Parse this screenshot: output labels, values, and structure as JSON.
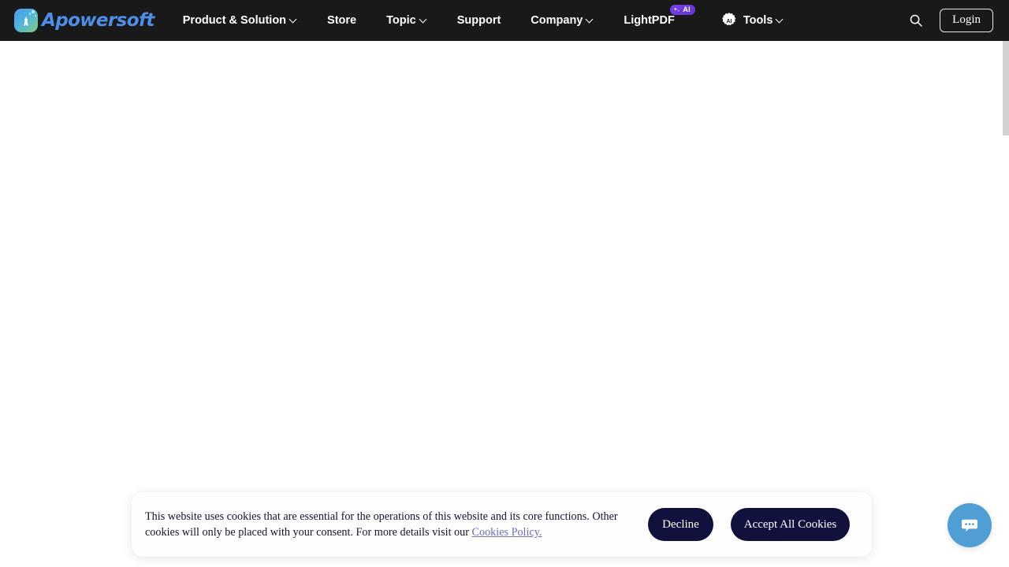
{
  "header": {
    "brand": {
      "name": "Apowersoft",
      "logo_icon": "apowersoft-logo-icon"
    },
    "nav": [
      {
        "label": "Product & Solution",
        "has_caret": true,
        "badge": null
      },
      {
        "label": "Store",
        "has_caret": false,
        "badge": null
      },
      {
        "label": "Topic",
        "has_caret": true,
        "badge": null
      },
      {
        "label": "Support",
        "has_caret": false,
        "badge": null
      },
      {
        "label": "Company",
        "has_caret": true,
        "badge": null
      },
      {
        "label": "LightPDF",
        "has_caret": false,
        "badge": "AI"
      },
      {
        "label": "Tools",
        "has_caret": true,
        "badge": null,
        "icon": "ai-gear-icon"
      }
    ],
    "search_icon": "search-icon",
    "login_label": "Login",
    "background_color": "#191919",
    "brand_text_color": "#4d8fe8",
    "badge_color": "#6f3ade"
  },
  "cookie_banner": {
    "text_part_1": "This website uses cookies that are essential for the operations of this website and its core functions. Other cookies will only be placed with your consent. For more details visit our ",
    "link_label": "Cookies Policy.",
    "decline_label": "Decline",
    "accept_label": "Accept All Cookies",
    "button_color": "#11113d",
    "link_color": "#6d6dc4"
  },
  "chat_widget": {
    "icon": "chat-bubble-icon",
    "color": "#4f9fd4"
  },
  "scrollbar": {
    "thumb_color": "#d2d2d2"
  }
}
